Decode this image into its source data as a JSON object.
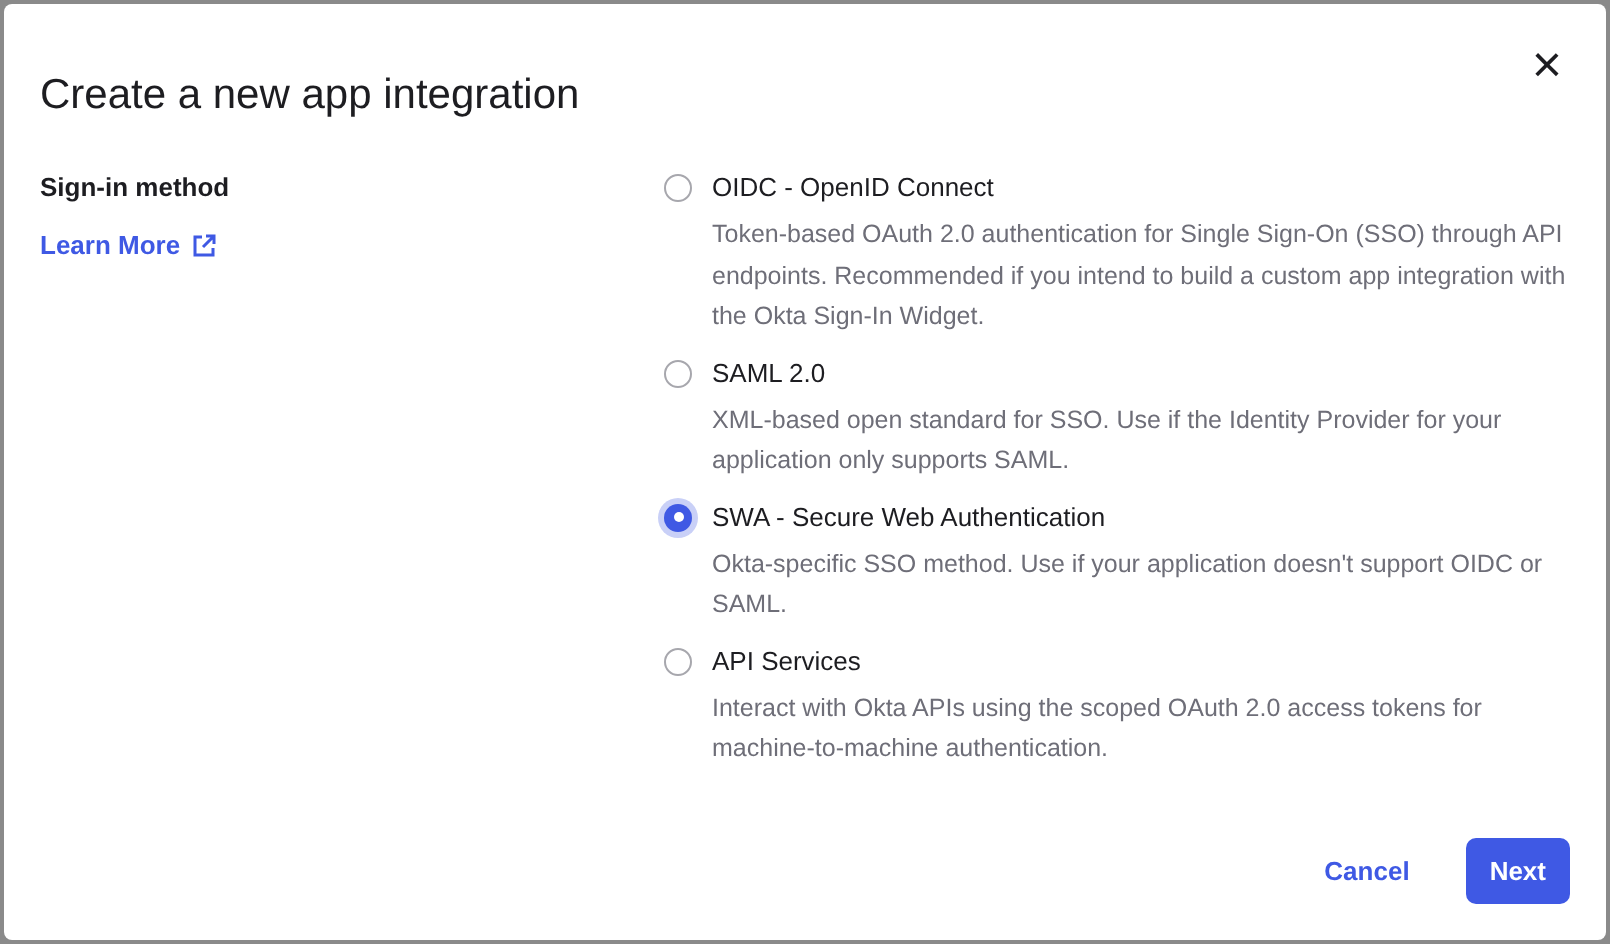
{
  "dialog": {
    "title": "Create a new app integration",
    "close": "×"
  },
  "section": {
    "label": "Sign-in method",
    "link": "Learn More"
  },
  "options": [
    {
      "label": "OIDC - OpenID Connect",
      "description": "Token-based OAuth 2.0 authentication for Single Sign-On (SSO) through API endpoints. Recommended if you intend to build a custom app integration with the Okta Sign-In Widget.",
      "selected": false
    },
    {
      "label": "SAML 2.0",
      "description": "XML-based open standard for SSO. Use if the Identity Provider for your application only supports SAML.",
      "selected": false
    },
    {
      "label": "SWA - Secure Web Authentication",
      "description": "Okta-specific SSO method. Use if your application doesn't support OIDC or SAML.",
      "selected": true
    },
    {
      "label": "API Services",
      "description": "Interact with Okta APIs using the scoped OAuth 2.0 access tokens for machine-to-machine authentication.",
      "selected": false
    }
  ],
  "buttons": {
    "cancel": "Cancel",
    "next": "Next"
  }
}
